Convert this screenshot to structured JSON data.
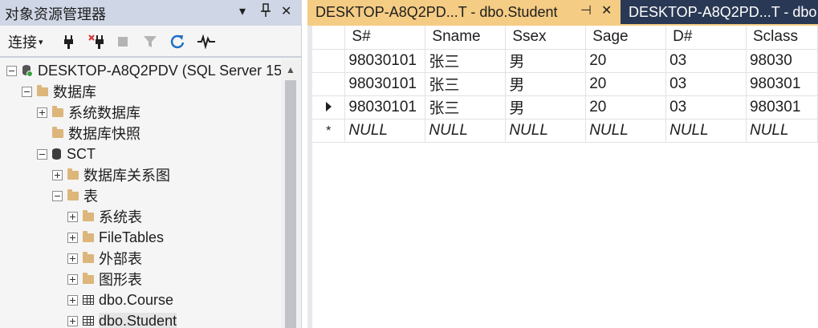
{
  "object_explorer": {
    "title": "对象资源管理器",
    "title_controls": [
      "▾",
      "⊥",
      "✕"
    ],
    "toolbar": {
      "connect_label": "连接",
      "connect_arrow": "▾"
    },
    "tree": [
      {
        "label": "DESKTOP-A8Q2PDV (SQL Server 15",
        "expander": "minus",
        "icon": "server-icon",
        "level": 0
      },
      {
        "label": "数据库",
        "expander": "minus",
        "icon": "folder-icon",
        "level": 1
      },
      {
        "label": "系统数据库",
        "expander": "plus",
        "icon": "folder-icon",
        "level": 2
      },
      {
        "label": "数据库快照",
        "expander": "none",
        "icon": "folder-icon",
        "level": 2
      },
      {
        "label": "SCT",
        "expander": "minus",
        "icon": "database-icon",
        "level": 2
      },
      {
        "label": "数据库关系图",
        "expander": "plus",
        "icon": "folder-icon",
        "level": 3
      },
      {
        "label": "表",
        "expander": "minus",
        "icon": "folder-icon",
        "level": 3
      },
      {
        "label": "系统表",
        "expander": "plus",
        "icon": "folder-icon",
        "level": 4
      },
      {
        "label": "FileTables",
        "expander": "plus",
        "icon": "folder-icon",
        "level": 4
      },
      {
        "label": "外部表",
        "expander": "plus",
        "icon": "folder-icon",
        "level": 4
      },
      {
        "label": "图形表",
        "expander": "plus",
        "icon": "folder-icon",
        "level": 4
      },
      {
        "label": "dbo.Course",
        "expander": "plus",
        "icon": "table-icon",
        "level": 4
      },
      {
        "label": "dbo.Student",
        "expander": "plus",
        "icon": "table-icon",
        "level": 4,
        "selected": true
      }
    ]
  },
  "tabs": {
    "active": {
      "label": "DESKTOP-A8Q2PD...T - dbo.Student",
      "pin": "⊣",
      "close": "✕"
    },
    "inactive": {
      "label": "DESKTOP-A8Q2PD...T - dbo"
    }
  },
  "grid": {
    "columns": [
      "S#",
      "Sname",
      "Ssex",
      "Sage",
      "D#",
      "Sclass"
    ],
    "rows": [
      {
        "marker": "",
        "cells": [
          "98030101",
          "张三",
          "男",
          "20",
          "03",
          "98030"
        ]
      },
      {
        "marker": "",
        "cells": [
          "98030101",
          "张三",
          "男",
          "20",
          "03",
          "980301"
        ]
      },
      {
        "marker": "current",
        "cells": [
          "98030101",
          "张三",
          "男",
          "20",
          "03",
          "980301"
        ]
      },
      {
        "marker": "new",
        "marker_text": "*",
        "cells": [
          "NULL",
          "NULL",
          "NULL",
          "NULL",
          "NULL",
          "NULL"
        ]
      }
    ]
  },
  "colors": {
    "title_bar": "#cfd6e5",
    "tab_strip": "#293955",
    "active_tab": "#f5cc84",
    "refresh_icon": "#1e6fc9"
  }
}
